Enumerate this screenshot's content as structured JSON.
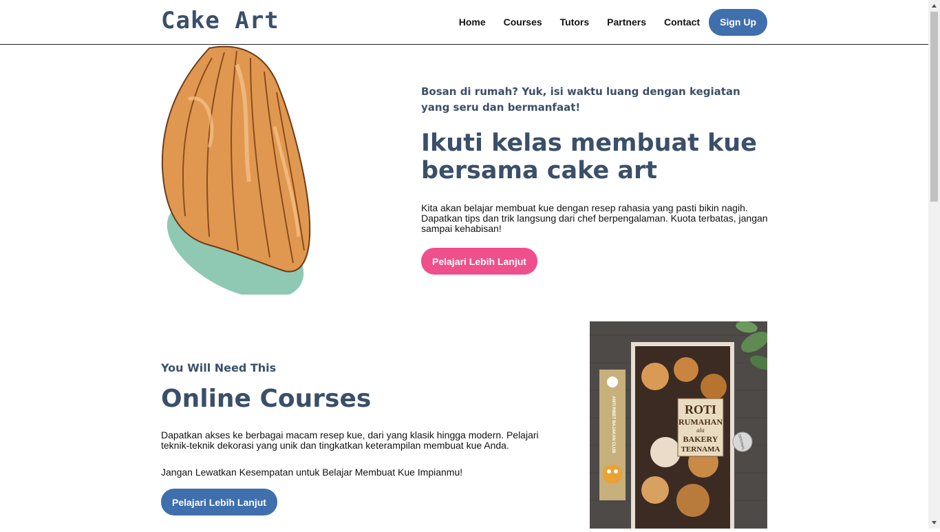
{
  "header": {
    "logo": "Cake Art",
    "nav": [
      "Home",
      "Courses",
      "Tutors",
      "Partners",
      "Contact"
    ],
    "signup_label": "Sign Up"
  },
  "hero": {
    "subtitle": "Bosan di rumah? Yuk, isi waktu luang dengan kegiatan yang seru dan bermanfaat!",
    "title": "Ikuti kelas membuat kue bersama cake art",
    "description": "Kita akan belajar membuat kue dengan resep rahasia yang pasti bikin nagih. Dapatkan tips dan trik langsung dari chef berpengalaman. Kuota terbatas, jangan sampai kehabisan!",
    "button_label": "Pelajari Lebih Lanjut"
  },
  "courses": {
    "eyebrow": "You Will Need This",
    "title": "Online Courses",
    "description": "Dapatkan akses ke berbagai macam resep kue, dari yang klasik hingga modern. Pelajari teknik-teknik dekorasi yang unik dan tingkatkan keterampilan membuat kue Anda.",
    "note": "Jangan Lewatkan Kesempatan untuk Belajar Membuat Kue Impianmu!",
    "button_label": "Pelajari Lebih Lanjut",
    "book": {
      "title_line1": "ROTI",
      "title_line2": "RUMAHAN",
      "title_line3": "ala",
      "title_line4": "BAKERY",
      "title_line5": "TERNAMA",
      "bookmark_text": "ANTI RIBET BAJAKAN CLUB",
      "sticker_text": "ORIGINAL"
    }
  },
  "colors": {
    "brand_blue": "#3f6fad",
    "heading": "#3a4f69",
    "pink": "#ef4f8a"
  }
}
